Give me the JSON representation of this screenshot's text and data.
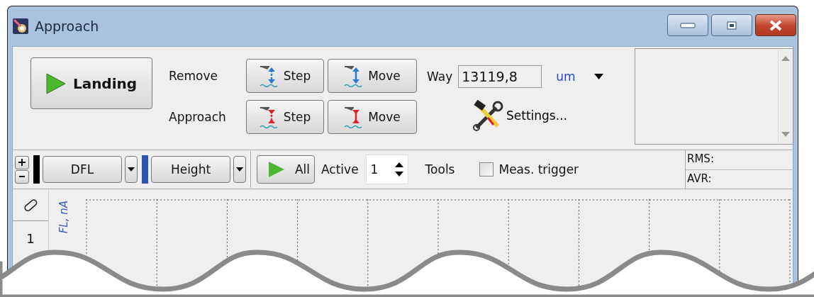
{
  "window": {
    "title": "Approach"
  },
  "landing_button": {
    "label": "Landing"
  },
  "motion_rows": [
    {
      "kind": "remove",
      "label": "Remove",
      "buttons": [
        {
          "kind": "step",
          "label": "Step"
        },
        {
          "kind": "move",
          "label": "Move"
        }
      ]
    },
    {
      "kind": "approach",
      "label": "Approach",
      "buttons": [
        {
          "kind": "step",
          "label": "Step"
        },
        {
          "kind": "move",
          "label": "Move"
        }
      ]
    }
  ],
  "way": {
    "label": "Way",
    "value": "13119,8",
    "unit": "um"
  },
  "settings_button": {
    "label": "Settings..."
  },
  "channels": [
    {
      "label": "DFL",
      "color": "#000000"
    },
    {
      "label": "Height",
      "color": "#2c54b4"
    }
  ],
  "all_button": {
    "label": "All"
  },
  "active": {
    "label": "Active",
    "value": "1"
  },
  "tools_label": "Tools",
  "meas_trigger": {
    "label": "Meas. trigger",
    "checked": false
  },
  "stats": [
    "RMS:",
    "AVR:"
  ],
  "plot": {
    "row_number": "1",
    "axis_label": "FL, nA"
  }
}
